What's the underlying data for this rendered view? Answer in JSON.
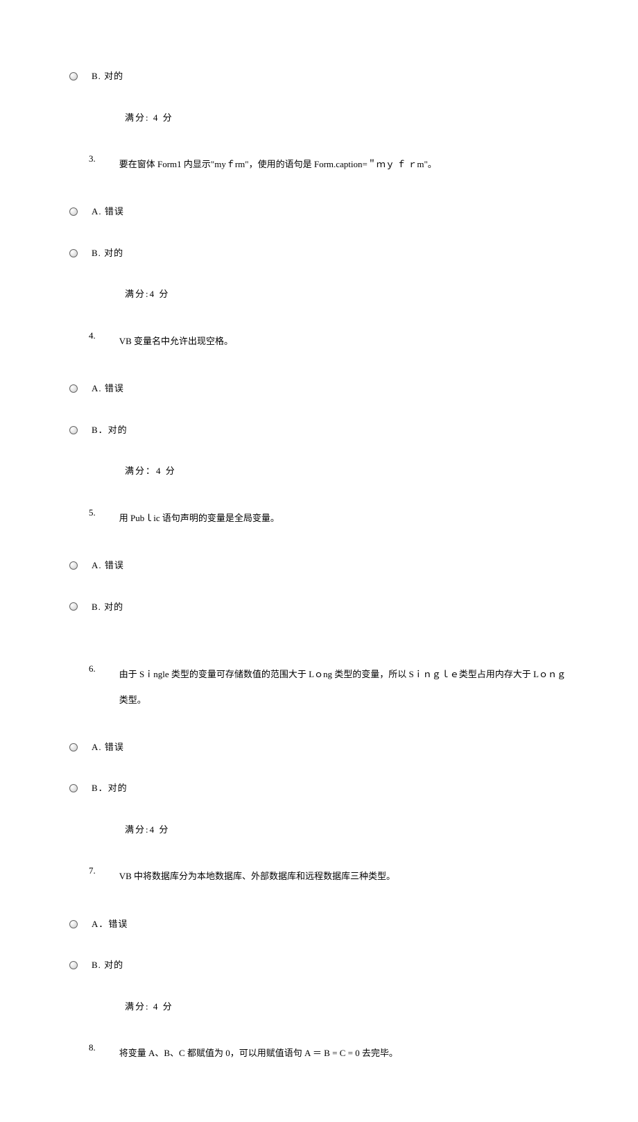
{
  "options": {
    "a_wrong": "A.  错误",
    "b_correct": "B.  对的",
    "a_wrong2": "A．错误",
    "b_correct2": "B．对的",
    "b_correct3": "B.   对的"
  },
  "score": {
    "s1": "满分: 4      分",
    "s2": "满分:4      分",
    "s3": "满分：4      分"
  },
  "questions": {
    "q3": {
      "num": "3.",
      "text": "要在窗体 Form1 内显示\"myｆrm\"，使用的语句是 Form.caption=＂ｍｙ ｆ ｒm\"。"
    },
    "q4": {
      "num": "4.",
      "text": "VB 变量名中允许出现空格。"
    },
    "q5": {
      "num": "5.",
      "text": "用 Pubｌic 语句声明的变量是全局变量。"
    },
    "q6": {
      "num": "6.",
      "text": "由于 Sｉngle 类型的变量可存储数值的范围大于 Lｏng 类型的变量，所以 Sｉｎｇｌｅ类型占用内存大于 Lｏｎｇ类型。"
    },
    "q7": {
      "num": "7.",
      "text": "VB 中将数据库分为本地数据库、外部数据库和远程数据库三种类型。"
    },
    "q8": {
      "num": "8.",
      "text": "将变量 A、B、C 都赋值为 0，可以用赋值语句 A ＝   B = C =    0 去完毕。"
    }
  }
}
